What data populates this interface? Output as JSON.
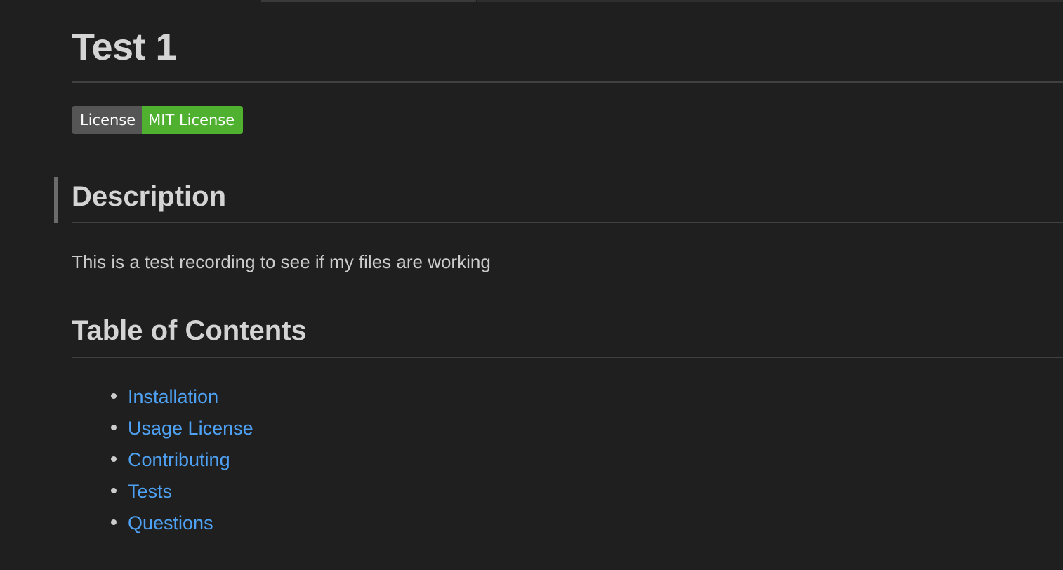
{
  "document": {
    "title": "Test 1",
    "badge": {
      "label": "License",
      "value": "MIT License",
      "label_color": "#555555",
      "value_color": "#4fb12f"
    },
    "description": {
      "heading": "Description",
      "text": "This is a test recording to see if my files are working"
    },
    "toc": {
      "heading": "Table of Contents",
      "items": [
        {
          "label": "Installation"
        },
        {
          "label": "Usage License"
        },
        {
          "label": "Contributing"
        },
        {
          "label": "Tests"
        },
        {
          "label": "Questions"
        }
      ]
    }
  },
  "colors": {
    "background": "#1f1f1f",
    "heading": "#d4d4d4",
    "text": "#cccccc",
    "link": "#4ea1f3",
    "rule": "#404040"
  }
}
